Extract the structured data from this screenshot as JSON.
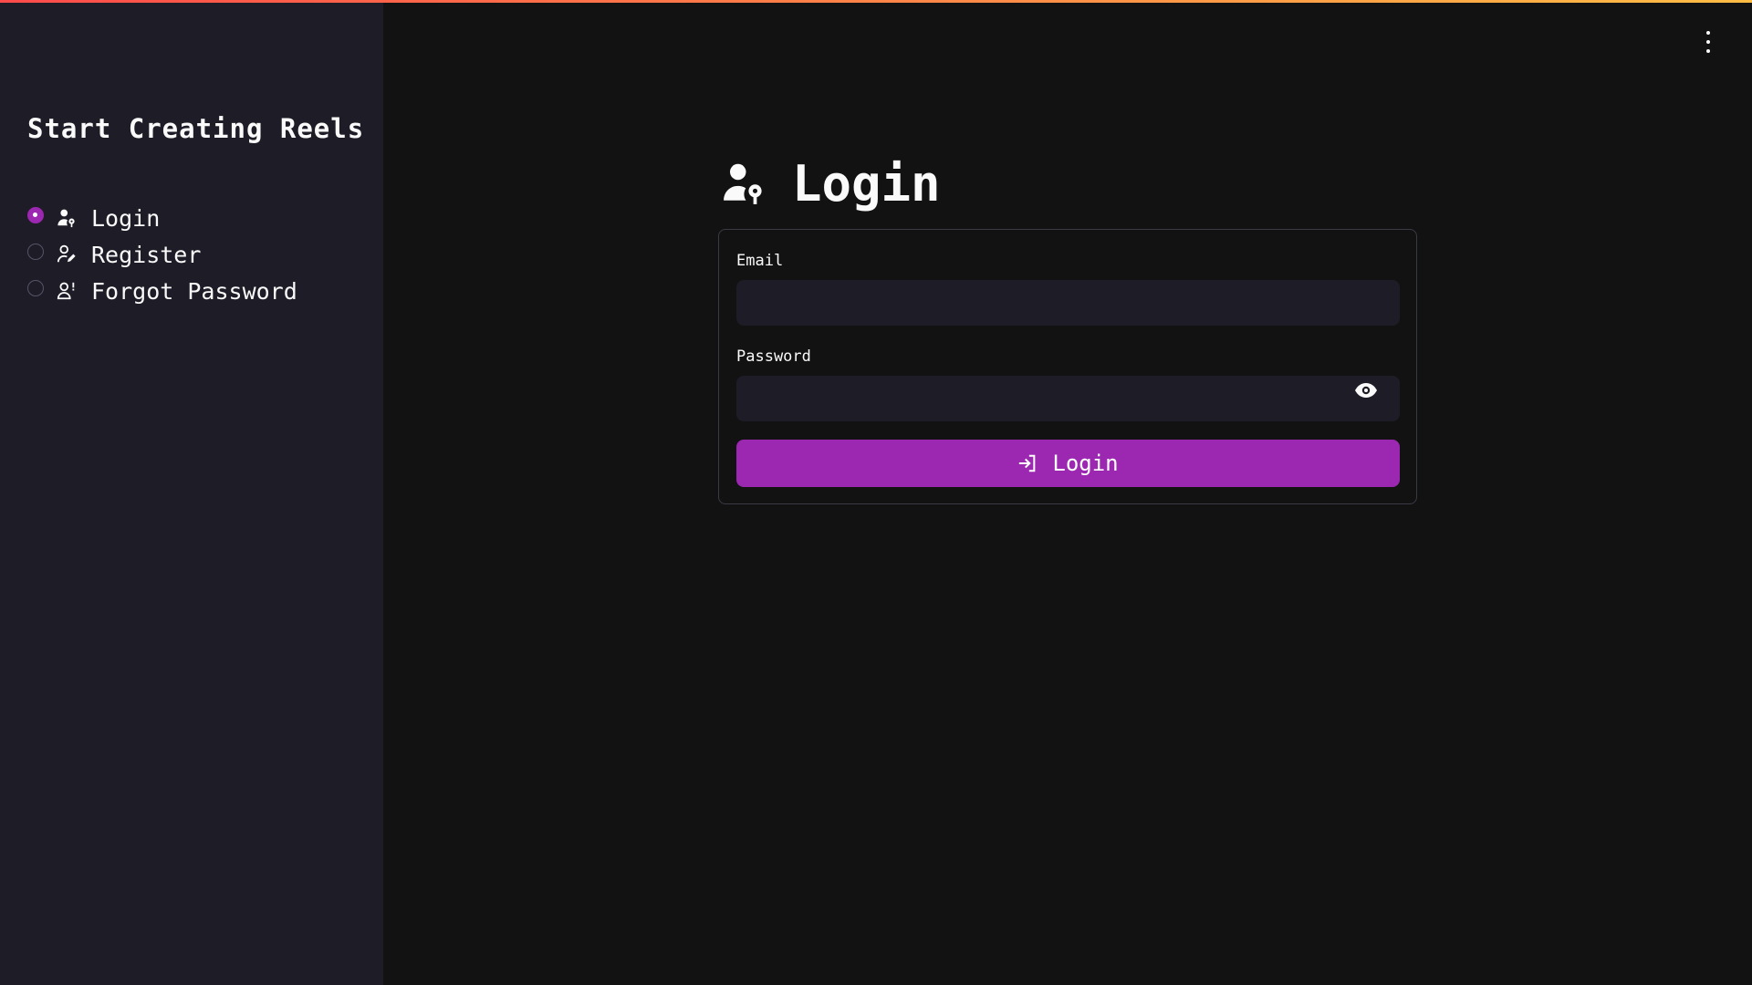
{
  "colors": {
    "accent": "#9c27b0",
    "background": "#121212",
    "sidebar_background": "#1e1c27",
    "input_background": "#1e1c27",
    "text": "#fafafa",
    "topbar_gradient_start": "#ff4b4b",
    "topbar_gradient_end": "#ffbd45"
  },
  "header": {
    "menu_icon": "vertical-ellipsis-icon"
  },
  "sidebar": {
    "title": "Start Creating Reels",
    "items": [
      {
        "label": "Login",
        "icon": "user-key-icon",
        "selected": true
      },
      {
        "label": "Register",
        "icon": "user-pen-icon",
        "selected": false
      },
      {
        "label": "Forgot Password",
        "icon": "user-exclamation-icon",
        "selected": false
      }
    ]
  },
  "main": {
    "heading": {
      "icon": "user-key-icon",
      "text": "Login"
    },
    "form": {
      "email_label": "Email",
      "email_value": "",
      "password_label": "Password",
      "password_value": "",
      "password_toggle_icon": "eye-icon",
      "submit_label": "Login",
      "submit_icon": "login-arrow-icon"
    }
  }
}
